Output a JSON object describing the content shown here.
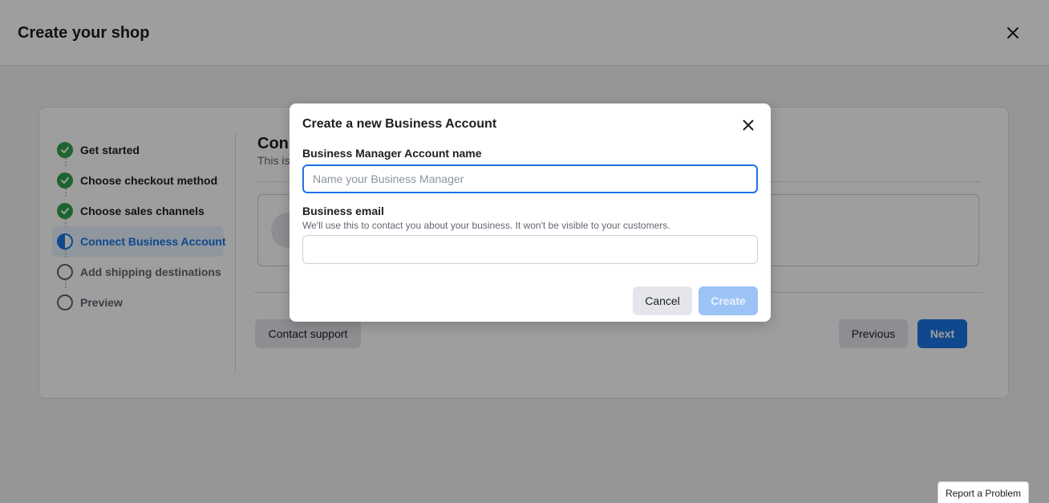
{
  "header": {
    "title": "Create your shop"
  },
  "steps": [
    {
      "label": "Get started",
      "state": "done"
    },
    {
      "label": "Choose checkout method",
      "state": "done"
    },
    {
      "label": "Choose sales channels",
      "state": "done"
    },
    {
      "label": "Connect Business Account",
      "state": "active"
    },
    {
      "label": "Add shipping destinations",
      "state": "pending"
    },
    {
      "label": "Preview",
      "state": "pending"
    }
  ],
  "content": {
    "title": "Conn",
    "subtitle": "This is"
  },
  "footer": {
    "contact_label": "Contact support",
    "previous_label": "Previous",
    "next_label": "Next"
  },
  "modal": {
    "title": "Create a new Business Account",
    "name_label": "Business Manager Account name",
    "name_placeholder": "Name your Business Manager",
    "name_value": "",
    "email_label": "Business email",
    "email_help": "We'll use this to contact you about your business. It won't be visible to your customers.",
    "email_value": "",
    "cancel_label": "Cancel",
    "create_label": "Create"
  },
  "report_label": "Report a Problem",
  "colors": {
    "accent": "#1b74e4",
    "success": "#31a24c",
    "overlay": "rgba(0,0,0,0.38)"
  }
}
